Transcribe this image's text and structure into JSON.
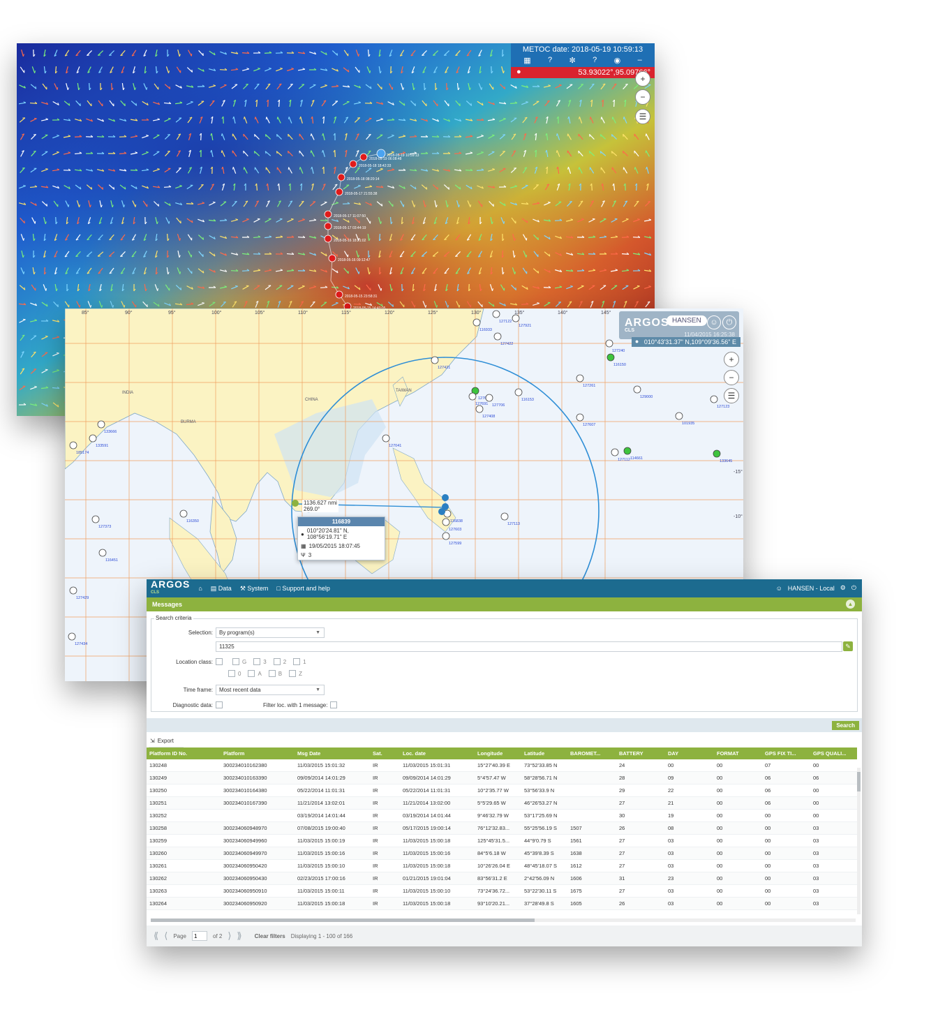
{
  "metoc": {
    "date_label": "METOC date: 2018-05-19 10:59:13",
    "icon_sep": "?",
    "coord": "53.93022°,95.09766°",
    "track_labels": [
      "2018-05-19 10:59:13",
      "2018-05-19 06:08:48",
      "2018-05-18 18:42:33",
      "2018-05-18 08:20:14",
      "2018-05-17 21:55:38",
      "2018-05-17 11:07:50",
      "2018-05-17 03:44:19",
      "2018-05-16 18:21:02",
      "2018-05-16 09:12:47",
      "2018-05-15 23:58:31",
      "2018-05-15 14:40:05",
      "2018-05-15 05:33:26"
    ]
  },
  "argos_map": {
    "logo": "ARGOS",
    "logo_sub": "CLS",
    "user": "HANSEN",
    "date": "11/04/2015 16:25:38",
    "coord": "010°43'31.37\" N,109°09'36.56\" E",
    "lon_labels": [
      "85°",
      "90°",
      "95°",
      "100°",
      "105°",
      "110°",
      "115°",
      "120°",
      "125°",
      "130°",
      "135°",
      "140°",
      "145°"
    ],
    "lat_labels": [
      "-15°",
      "-10°"
    ],
    "region_labels": [
      "INDIA",
      "CHINA",
      "TAIWAN",
      "BURMA"
    ],
    "distance": "1136.627 nmi",
    "bearing": "269.0°",
    "platform_labels": [
      "133666",
      "185174",
      "133591",
      "127373",
      "116451",
      "127429",
      "127434",
      "116350",
      "127421",
      "127610",
      "127691",
      "127706",
      "116153",
      "127408",
      "127422",
      "127240",
      "116150",
      "127261",
      "129000",
      "127607",
      "101935",
      "133645",
      "114661",
      "127112",
      "116838",
      "127603",
      "127599",
      "116933",
      "127113",
      "127921",
      "127122",
      "127123",
      "127041"
    ],
    "popup": {
      "title": "116839",
      "position": "010°20'24.81\" N, 108°56'19.71\" E",
      "date": "19/05/2015 18:07:45",
      "count": "3"
    }
  },
  "messages": {
    "logo": "ARGOS",
    "logo_sub": "CLS",
    "nav": {
      "data": "Data",
      "system": "System",
      "support": "Support and help"
    },
    "user": "HANSEN - Local",
    "section_title": "Messages",
    "criteria": {
      "legend": "Search criteria",
      "selection_label": "Selection:",
      "selection_value": "By program(s)",
      "program_value": "11325",
      "location_class_label": "Location class:",
      "classes_row1": [
        "G",
        "3",
        "2",
        "1"
      ],
      "classes_row2": [
        "0",
        "A",
        "B",
        "Z"
      ],
      "time_frame_label": "Time frame:",
      "time_frame_value": "Most recent data",
      "diagnostic_label": "Diagnostic data:",
      "filter_label": "Filter loc. with 1 message:"
    },
    "search_button": "Search",
    "export_label": "Export",
    "columns": [
      "Platform ID No.",
      "Platform",
      "Msg Date",
      "Sat.",
      "Loc. date",
      "Longitude",
      "Latitude",
      "BAROMET...",
      "BATTERY",
      "DAY",
      "FORMAT",
      "GPS FIX TI...",
      "GPS QUALI..."
    ],
    "rows": [
      [
        "130248",
        "300234010162380",
        "11/03/2015 15:01:32",
        "IR",
        "11/03/2015 15:01:31",
        "15°27'40.39 E",
        "73°52'33.85 N",
        "",
        "24",
        "00",
        "00",
        "07",
        "00"
      ],
      [
        "130249",
        "300234010163390",
        "09/09/2014 14:01:29",
        "IR",
        "09/09/2014 14:01:29",
        "5°4'57.47 W",
        "58°28'56.71 N",
        "",
        "28",
        "09",
        "00",
        "06",
        "06"
      ],
      [
        "130250",
        "300234010164380",
        "05/22/2014 11:01:31",
        "IR",
        "05/22/2014 11:01:31",
        "10°2'35.77 W",
        "53°56'33.9 N",
        "",
        "29",
        "22",
        "00",
        "06",
        "00"
      ],
      [
        "130251",
        "300234010167390",
        "11/21/2014 13:02:01",
        "IR",
        "11/21/2014 13:02:00",
        "5°5'29.65 W",
        "46°26'53.27 N",
        "",
        "27",
        "21",
        "00",
        "06",
        "00"
      ],
      [
        "130252",
        "",
        "03/19/2014 14:01:44",
        "IR",
        "03/19/2014 14:01:44",
        "9°46'32.79 W",
        "53°17'25.69 N",
        "",
        "30",
        "19",
        "00",
        "00",
        "00"
      ],
      [
        "130258",
        "300234060948970",
        "07/08/2015 19:00:40",
        "IR",
        "05/17/2015 19:00:14",
        "76°12'32.83...",
        "55°25'56.19 S",
        "1507",
        "26",
        "08",
        "00",
        "00",
        "03"
      ],
      [
        "130259",
        "300234060949960",
        "11/03/2015 15:00:19",
        "IR",
        "11/03/2015 15:00:18",
        "125°45'31.5...",
        "44°9'0.79 S",
        "1561",
        "27",
        "03",
        "00",
        "00",
        "03"
      ],
      [
        "130260",
        "300234060949970",
        "11/03/2015 15:00:16",
        "IR",
        "11/03/2015 15:00:16",
        "84°5'6.18 W",
        "45°39'8.39 S",
        "1638",
        "27",
        "03",
        "00",
        "00",
        "03"
      ],
      [
        "130261",
        "300234060950420",
        "11/03/2015 15:00:10",
        "IR",
        "11/03/2015 15:00:18",
        "10°26'26.04 E",
        "48°45'18.07 S",
        "1612",
        "27",
        "03",
        "00",
        "00",
        "03"
      ],
      [
        "130262",
        "300234060950430",
        "02/23/2015 17:00:16",
        "IR",
        "01/21/2015 19:01:04",
        "83°56'31.2 E",
        "2°42'56.09 N",
        "1606",
        "31",
        "23",
        "00",
        "00",
        "03"
      ],
      [
        "130263",
        "300234060950910",
        "11/03/2015 15:00:11",
        "IR",
        "11/03/2015 15:00:10",
        "73°24'36.72...",
        "53°22'30.11 S",
        "1675",
        "27",
        "03",
        "00",
        "00",
        "03"
      ],
      [
        "130264",
        "300234060950920",
        "11/03/2015 15:00:18",
        "IR",
        "11/03/2015 15:00:18",
        "93°10'20.21...",
        "37°28'49.8 S",
        "1605",
        "26",
        "03",
        "00",
        "00",
        "03"
      ]
    ],
    "pager": {
      "page_label": "Page",
      "page_value": "1",
      "of_label": "of 2",
      "clear_filters": "Clear filters",
      "displaying": "Displaying 1 - 100 of 166"
    }
  },
  "colors": {
    "argos_blue": "#1c6b8f",
    "argos_green": "#8db23f",
    "metoc_blue": "#1f6fb4",
    "alert_red": "#d9232e"
  }
}
